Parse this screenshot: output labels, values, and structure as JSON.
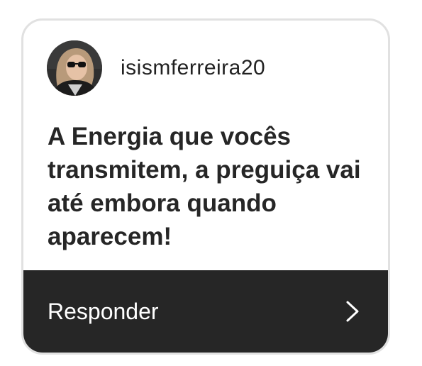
{
  "question_card": {
    "username": "isismferreira20",
    "message": "A Energia que vocês transmitem, a preguiça vai até embora quando aparecem!",
    "reply_label": "Responder",
    "icons": {
      "avatar": "profile-photo",
      "chevron": "chevron-right-icon"
    },
    "colors": {
      "footer_background": "#262626",
      "card_border": "#e1e1e1",
      "text": "#262626"
    }
  }
}
